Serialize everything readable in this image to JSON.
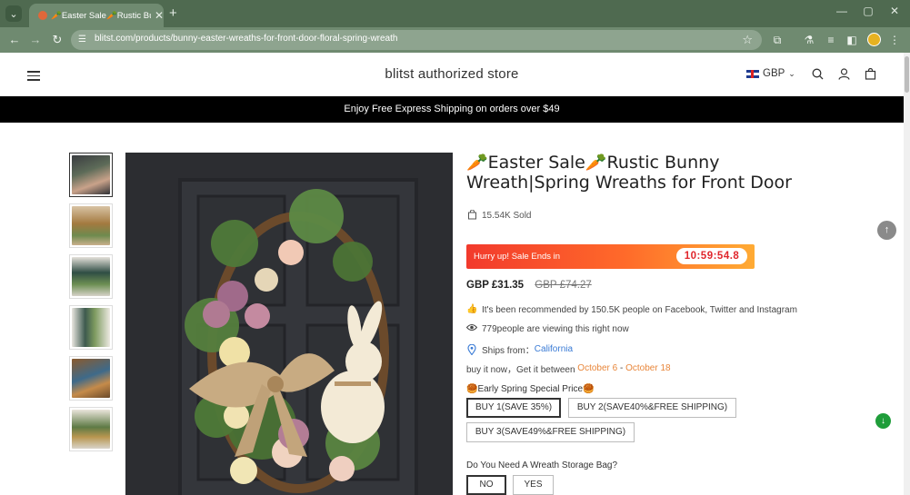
{
  "browser": {
    "tab_title": "🥕Easter Sale🥕Rustic Bunny",
    "new_tab": "+",
    "url": "blitst.com/products/bunny-easter-wreaths-for-front-door-floral-spring-wreath"
  },
  "header": {
    "store_name": "blitst authorized store",
    "currency": "GBP"
  },
  "promo": "Enjoy Free Express Shipping on orders over $49",
  "product": {
    "title": "🥕Easter Sale🥕Rustic Bunny Wreath|Spring Wreaths for Front Door",
    "sold": "15.54K Sold",
    "countdown_text": "Hurry up! Sale Ends in",
    "countdown_timer": "10:59:54.8",
    "price_now": "GBP £31.35",
    "price_was": "GBP £74.27",
    "recommended": "It's been recommended by 150.5K people on Facebook, Twitter and Instagram",
    "viewing": "779people are viewing this right now",
    "ships_from_label": "Ships from：",
    "ships_from_value": "California",
    "delivery_prefix": "buy it now，Get it between ",
    "delivery_start": "October 6",
    "delivery_sep": " - ",
    "delivery_end": "October 18",
    "option1_label": "🥮Early Spring Special Price🥮",
    "option1_values": [
      "BUY 1(SAVE 35%)",
      "BUY 2(SAVE40%&FREE SHIPPING)",
      "BUY 3(SAVE49%&FREE SHIPPING)"
    ],
    "option2_label": "Do You Need A Wreath Storage Bag?",
    "option2_values": [
      "NO",
      "YES"
    ]
  },
  "icons": [
    "tab-menu-icon",
    "close-icon",
    "back-icon",
    "forward-icon",
    "reload-icon",
    "star-icon",
    "menu-icon",
    "search-icon",
    "account-icon",
    "cart-icon",
    "bag-icon",
    "thumbs-up-icon",
    "eye-icon",
    "location-pin-icon",
    "arrow-up-icon",
    "help-icon"
  ],
  "colors": {
    "accent_orange": "#e8863a",
    "link_blue": "#3a7bd5",
    "timer_red": "#e0262c",
    "chrome_green": "#4f6a50"
  }
}
